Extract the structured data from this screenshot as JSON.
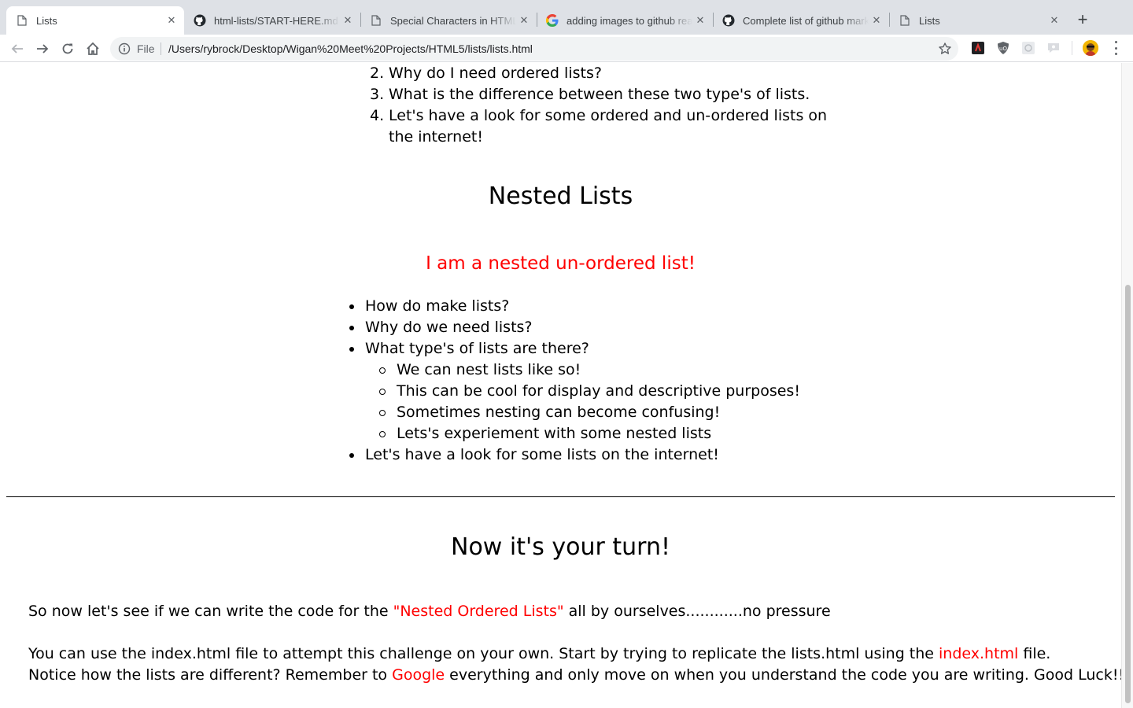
{
  "browser": {
    "tabs": [
      {
        "title": "Lists",
        "active": true,
        "icon": "page-icon"
      },
      {
        "title": "html-lists/START-HERE.md at",
        "active": false,
        "icon": "github-icon"
      },
      {
        "title": "Special Characters in HTML",
        "active": false,
        "icon": "page-icon"
      },
      {
        "title": "adding images to github readme",
        "active": false,
        "icon": "google-icon"
      },
      {
        "title": "Complete list of github markdown",
        "active": false,
        "icon": "github-icon"
      },
      {
        "title": "Lists",
        "active": false,
        "icon": "page-icon"
      }
    ],
    "address": {
      "scheme_label": "File",
      "url": "/Users/rybrock/Desktop/Wigan%20Meet%20Projects/HTML5/lists/lists.html"
    }
  },
  "page": {
    "ordered_list": [
      {
        "num": "2.",
        "text": "Why do I need ordered lists?"
      },
      {
        "num": "3.",
        "text": "What is the difference between these two type's of lists."
      },
      {
        "num": "4.",
        "text": "Let's have a look for some ordered and un-ordered lists on the internet!"
      }
    ],
    "nested_heading": "Nested Lists",
    "nested_subheading": "I am a nested un-ordered list!",
    "unordered_list": {
      "item1": "How do make lists?",
      "item2": "Why do we need lists?",
      "item3": "What type's of lists are there?",
      "sub": [
        "We can nest lists like so!",
        "This can be cool for display and descriptive purposes!",
        "Sometimes nesting can become confusing!",
        "Lets's experiement with some nested lists"
      ],
      "item4": "Let's have a look for some lists on the internet!"
    },
    "turn_heading": "Now it's your turn!",
    "para1": {
      "before": "So now let's see if we can write the code for the ",
      "link": "\"Nested Ordered Lists\"",
      "after": " all by ourselves............no pressure"
    },
    "para2": {
      "before": "You can use the index.html file to attempt this challenge on your own. Start by trying to replicate the lists.html using the ",
      "link": "index.html",
      "after": " file."
    },
    "para3": {
      "before": "Notice how the lists are different? Remember to ",
      "link": "Google",
      "after": " everything and only move on when you understand the code you are writing. Good Luck!!"
    }
  },
  "colors": {
    "link": "#ff0000",
    "tabstrip": "#dee1e6"
  }
}
